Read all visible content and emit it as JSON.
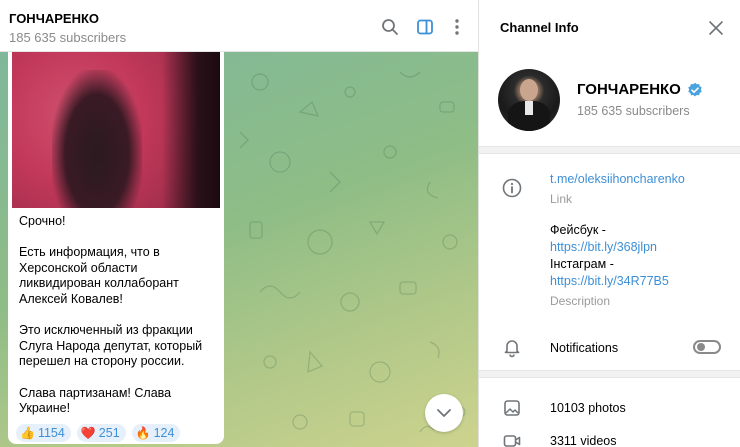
{
  "chat": {
    "title": "ГОНЧАРЕНКО",
    "subtitle": "185 635 subscribers",
    "header_icons": [
      "search-icon",
      "sidebar-toggle-icon",
      "more-vertical-icon"
    ]
  },
  "message": {
    "text": "Срочно!\n\nЕсть информация, что в Херсонской области ликвидирован коллаборант Алексей Ковалев!\n\nЭто исключенный из фракции Слуга Народа депутат, который перешел на сторону россии.\n\nСлава партизанам! Слава Украине!",
    "reactions": [
      {
        "emoji": "👍",
        "count": "1154"
      },
      {
        "emoji": "❤️",
        "count": "251"
      },
      {
        "emoji": "🔥",
        "count": "124"
      }
    ]
  },
  "info_panel": {
    "title": "Channel Info",
    "channel_name": "ГОНЧАРЕНКО",
    "subscribers": "185 635 subscribers",
    "link": "t.me/oleksiihoncharenko",
    "link_caption": "Link",
    "description": {
      "line1": "Фейсбук -",
      "link1": "https://bit.ly/368jlpn",
      "line2": "Інстаграм -",
      "link2": "https://bit.ly/34R77B5"
    },
    "description_caption": "Description",
    "notifications_label": "Notifications",
    "notifications_on": false,
    "photos": "10103 photos",
    "videos": "3311 videos"
  },
  "colors": {
    "accent": "#3d8fd6",
    "verified": "#4aa3df",
    "secondary_text": "#8a8a8a"
  }
}
